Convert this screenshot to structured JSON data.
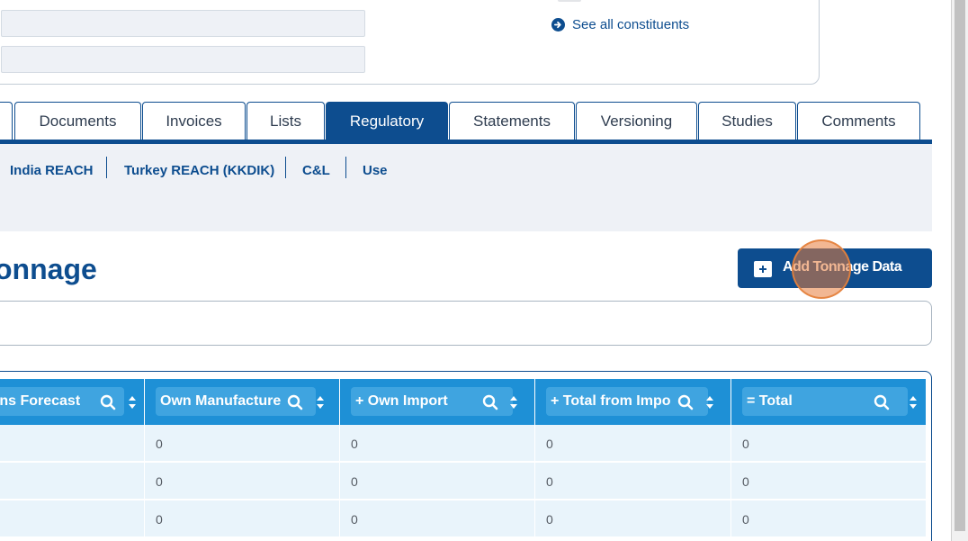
{
  "top_panel": {
    "see_all_link": "See all constituents"
  },
  "tabs": [
    {
      "label": "Documents",
      "active": false
    },
    {
      "label": "Invoices",
      "active": false
    },
    {
      "label": "Lists",
      "active": false
    },
    {
      "label": "Regulatory",
      "active": true
    },
    {
      "label": "Statements",
      "active": false
    },
    {
      "label": "Versioning",
      "active": false
    },
    {
      "label": "Studies",
      "active": false
    },
    {
      "label": "Comments",
      "active": false
    }
  ],
  "subtabs": [
    "India REACH",
    "Turkey REACH (KKDIK)",
    "C&L",
    "Use"
  ],
  "section": {
    "heading": "onnage",
    "add_button_label": "Add Tonnage Data"
  },
  "table": {
    "columns": [
      "ains Forecast",
      "Own Manufacture",
      "+ Own Import",
      "+ Total from Impo",
      "= Total"
    ],
    "rows": [
      [
        "",
        "0",
        "0",
        "0",
        "0"
      ],
      [
        "",
        "0",
        "0",
        "0",
        "0"
      ],
      [
        "",
        "0",
        "0",
        "0",
        "0"
      ]
    ]
  },
  "colors": {
    "primary": "#0d4d8f",
    "table_header": "#1e90d6",
    "row_bg": "#e9f4fb",
    "subband_bg": "#eef1f6"
  }
}
